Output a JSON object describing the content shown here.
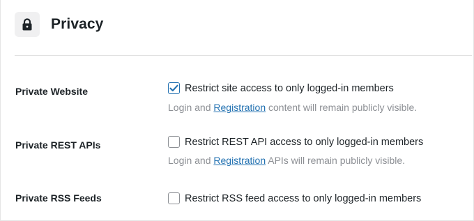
{
  "section": {
    "title": "Privacy",
    "icon": "lock-icon"
  },
  "settings": [
    {
      "label": "Private Website",
      "checkbox_label": "Restrict site access to only logged-in members",
      "checked": true,
      "help_prefix": "Login and ",
      "help_link": "Registration",
      "help_suffix": " content will remain publicly visible."
    },
    {
      "label": "Private REST APIs",
      "checkbox_label": "Restrict REST API access to only logged-in members",
      "checked": false,
      "help_prefix": "Login and ",
      "help_link": "Registration",
      "help_suffix": " APIs will remain publicly visible."
    },
    {
      "label": "Private RSS Feeds",
      "checkbox_label": "Restrict RSS feed access to only logged-in members",
      "checked": false
    }
  ],
  "colors": {
    "accent": "#2271b1",
    "muted_text": "#8c8f94",
    "text": "#1d2327"
  }
}
